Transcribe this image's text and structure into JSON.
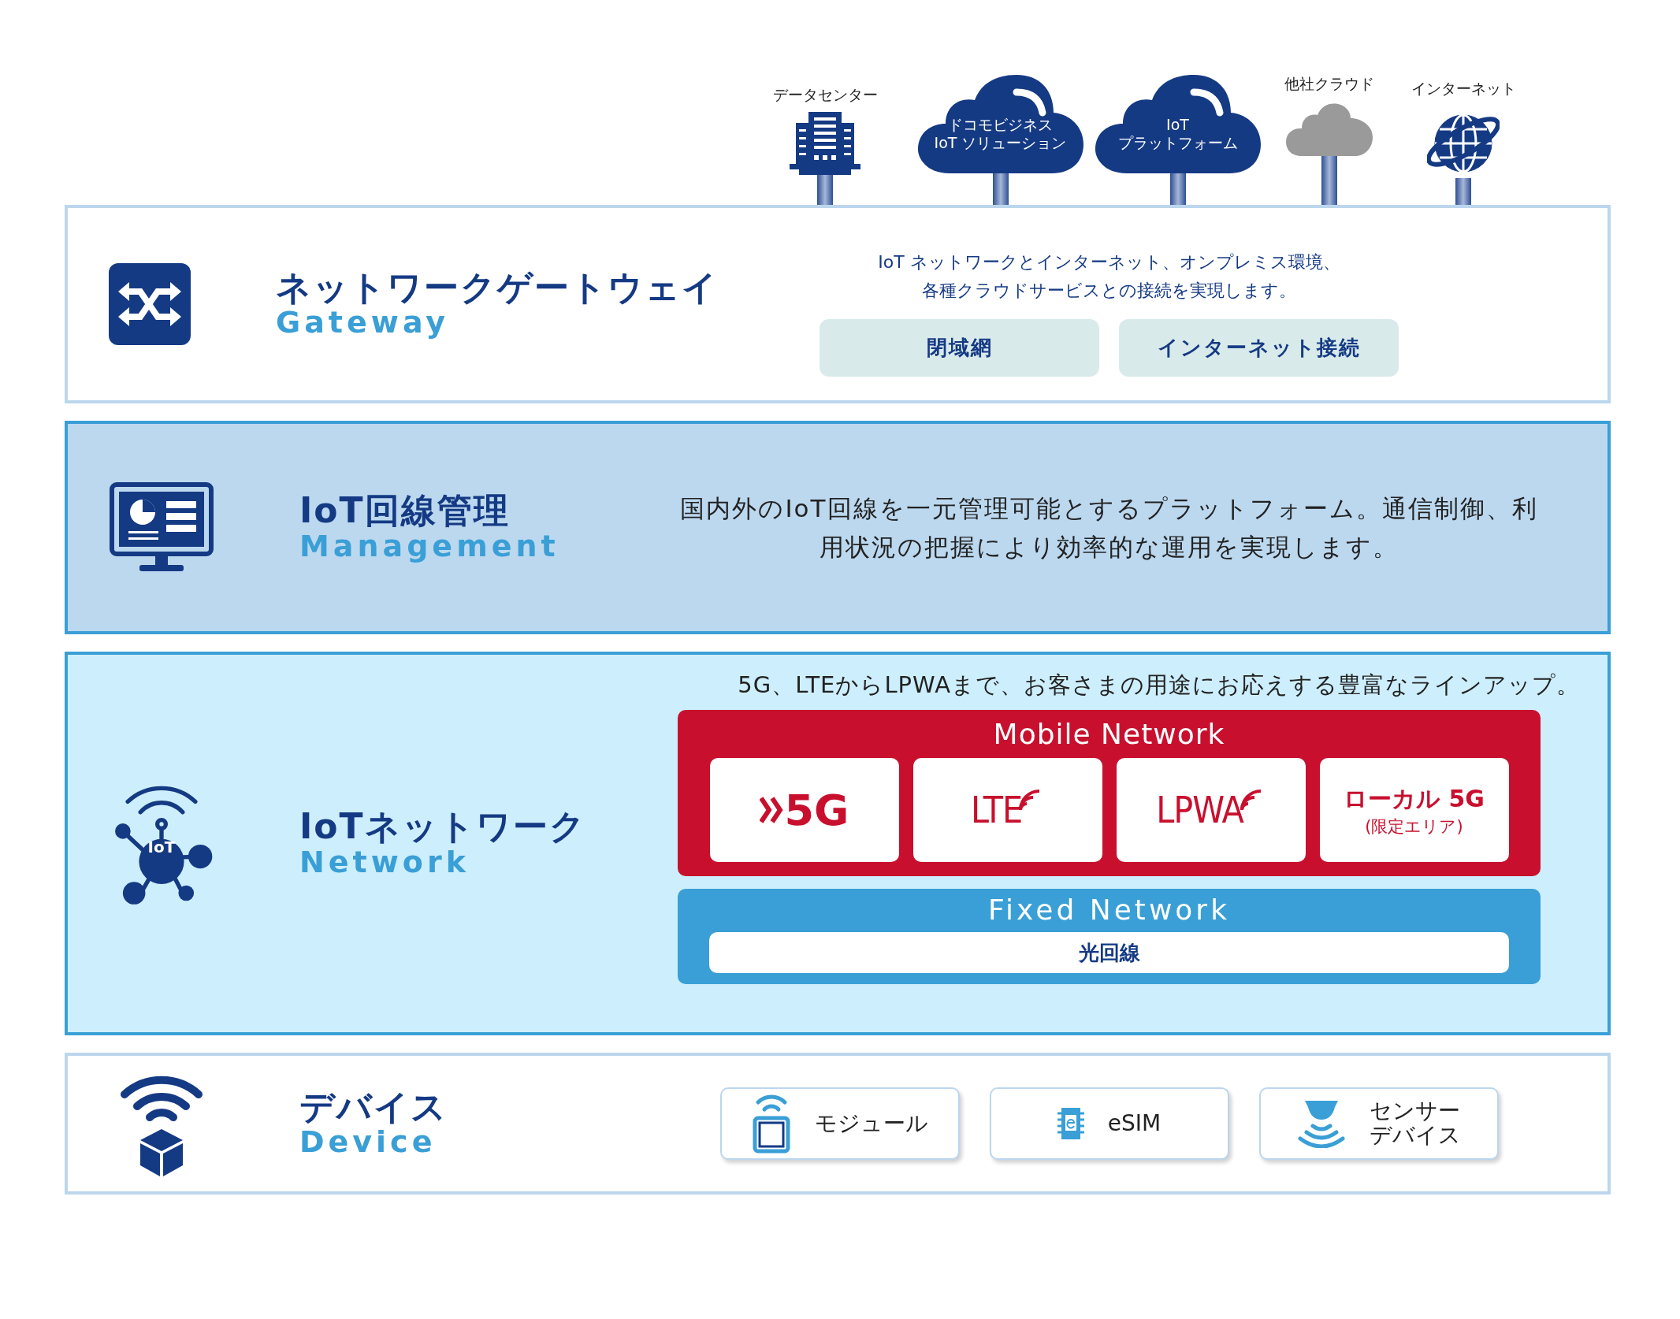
{
  "endpoints": [
    {
      "kind": "building",
      "label": "データセンター"
    },
    {
      "kind": "cloud",
      "lines": [
        "ドコモビジネス",
        "IoT ソリューション"
      ]
    },
    {
      "kind": "cloud",
      "lines": [
        "IoT",
        "プラットフォーム"
      ]
    },
    {
      "kind": "gray-cloud",
      "label": "他社クラウド"
    },
    {
      "kind": "globe",
      "label": "インターネット"
    }
  ],
  "layers": [
    {
      "kind": "gateway",
      "title": "ネットワークゲートウェイ",
      "subtitle": "Gateway",
      "description": [
        "IoT ネットワークとインターネット、オンプレミス環境、",
        "各種クラウドサービスとの接続を実現します。"
      ],
      "options": [
        "閉域網",
        "インターネット接続"
      ]
    },
    {
      "kind": "management",
      "title": "IoT回線管理",
      "subtitle": "Management",
      "description": [
        "国内外のIoT回線を一元管理可能とするプラットフォーム。通信制御、利",
        "用状況の把握により効率的な運用を実現します。"
      ]
    },
    {
      "kind": "network",
      "title": "IoTネットワーク",
      "subtitle": "Network",
      "icon_label": "IoT",
      "description": [
        "5G、LTEからLPWAまで、お客さまの用途にお応えする豊富なラインアップ。"
      ],
      "mobile": {
        "title": "Mobile Network",
        "items": [
          {
            "kind": "fiveg",
            "label": "5G"
          },
          {
            "kind": "lte",
            "label": "LTE"
          },
          {
            "kind": "lpwa",
            "label": "LPWA"
          },
          {
            "kind": "local",
            "label": "ローカル 5G",
            "note": "(限定エリア)"
          }
        ]
      },
      "fixed": {
        "title": "Fixed Network",
        "items": [
          "光回線"
        ]
      }
    },
    {
      "kind": "device",
      "title": "デバイス",
      "subtitle": "Device",
      "items": [
        {
          "kind": "module",
          "lines": [
            "モジュール"
          ]
        },
        {
          "kind": "esim",
          "lines": [
            "eSIM"
          ]
        },
        {
          "kind": "sensor",
          "lines": [
            "センサー",
            "デバイス"
          ]
        }
      ]
    }
  ]
}
